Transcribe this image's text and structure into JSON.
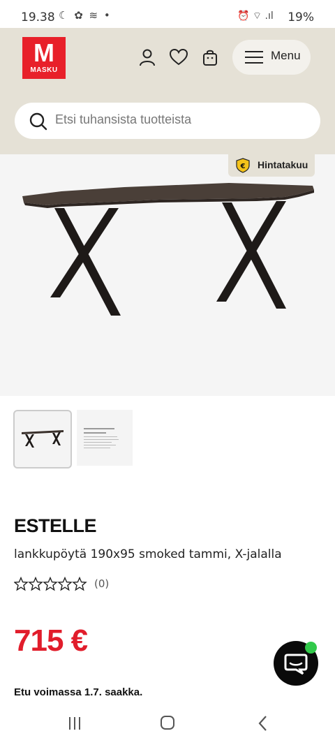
{
  "status_bar": {
    "time": "19.38",
    "left_icons": "☾ ✿ ≋ •",
    "right_icons": "⏰ ⌔ .ıl",
    "battery": "19%"
  },
  "header": {
    "logo_letter": "M",
    "logo_text": "MASKU",
    "menu_label": "Menu",
    "search_placeholder": "Etsi tuhansista tuotteista"
  },
  "hero": {
    "badge_label": "Hintatakuu",
    "badge_icon_glyph": "€"
  },
  "product": {
    "brand": "ESTELLE",
    "subtitle": "lankkupöytä 190x95 smoked tammi, X-jalalla",
    "rating_count": "(0)",
    "rating_stars": 0,
    "price": "715 €",
    "offer": "Etu voimassa 1.7. saakka."
  },
  "colors": {
    "brand_red": "#e8202a",
    "header_bg": "#e5e1d6",
    "price_red": "#e11d2b",
    "chat_online": "#31c94a"
  },
  "icons": [
    "user-icon",
    "heart-icon",
    "bag-icon",
    "hamburger-icon",
    "search-icon",
    "shield-euro-icon",
    "star-icon",
    "chat-icon",
    "recent-apps-icon",
    "home-icon",
    "back-icon"
  ]
}
